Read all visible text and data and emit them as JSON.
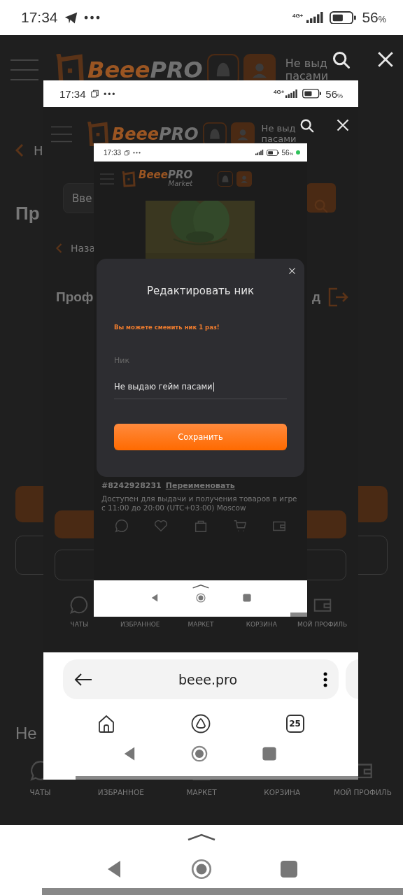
{
  "status_bar": {
    "time": "17:34",
    "network": "4G+",
    "battery": "56",
    "battery_unit": "%"
  },
  "page": {
    "header": {
      "logo_part1": "Beee",
      "logo_part2": "PRO",
      "user_name": [
        "Не выд",
        "пасами"
      ]
    },
    "back_label": "Н",
    "title": "Пр",
    "footer_text": "Не",
    "nav": [
      "ЧАТЫ",
      "ИЗБРАННОЕ",
      "МАРКЕТ",
      "КОРЗИНА",
      "МОЙ ПРОФИЛЬ"
    ]
  },
  "screenshot": {
    "status_bar": {
      "time": "17:34",
      "network": "4G+",
      "battery": "56",
      "battery_unit": "%"
    },
    "page": {
      "header": {
        "logo_part1": "Beee",
        "logo_part2": "PRO",
        "user_name": [
          "Не выд",
          "пасами"
        ]
      },
      "search_placeholder": "Вве",
      "back_label": "Наза",
      "title": "Проф",
      "title_tail": "д",
      "nav": [
        "ЧАТЫ",
        "ИЗБРАННОЕ",
        "МАРКЕТ",
        "КОРЗИНА",
        "МОЙ ПРОФИЛЬ"
      ]
    },
    "browser": {
      "url": "beee.pro",
      "tab_count": "25"
    },
    "screenshot": {
      "status_bar": {
        "time": "17:33",
        "battery": "56",
        "battery_unit": "%",
        "recording": true
      },
      "page": {
        "header": {
          "logo_part1": "Beee",
          "logo_part2": "PRO",
          "logo_sub": "Market"
        },
        "user_id": "#8242928231",
        "rename_link": "Переименовать",
        "availability": [
          "Доступен для выдачи и получения товаров в игре",
          "с 11:00 до 20:00 (UTC+03:00) Moscow"
        ]
      },
      "modal": {
        "title": "Редактировать ник",
        "notice": "Вы можете сменить ник 1 раз!",
        "field_label": "Ник",
        "field_value": "Не выдаю гейм пасами",
        "save_button": "Сохранить"
      }
    }
  }
}
